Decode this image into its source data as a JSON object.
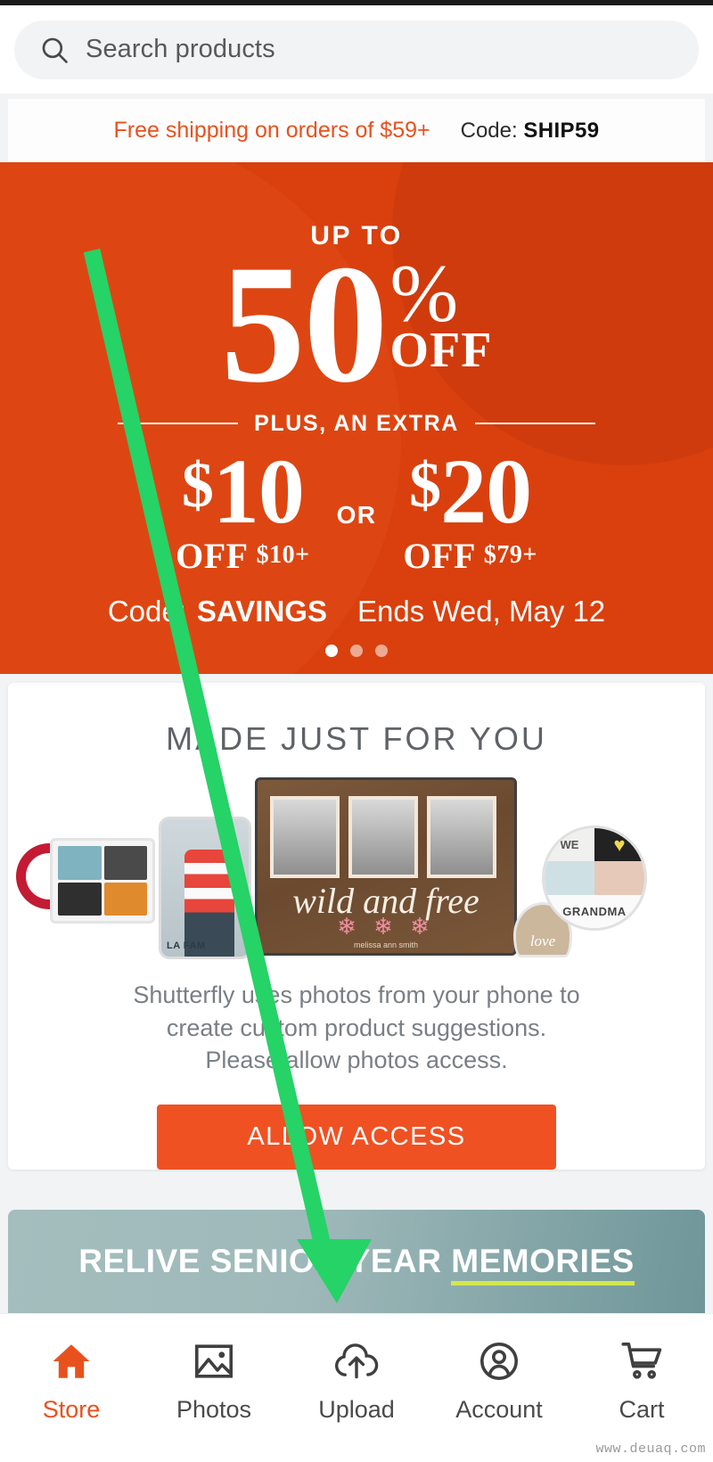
{
  "search": {
    "placeholder": "Search products",
    "icon": "search-icon"
  },
  "promo_strip": {
    "offer": "Free shipping on orders of $59+",
    "code_label": "Code:",
    "code_value": "SHIP59"
  },
  "hero": {
    "up_to": "UP TO",
    "percent_number": "50",
    "percent_symbol": "%",
    "off": "OFF",
    "plus_extra": "PLUS, AN EXTRA",
    "deal_left_amount": "10",
    "deal_left_sub_prefix": "OFF",
    "deal_left_sub_amount": "$10+",
    "or": "OR",
    "deal_right_amount": "20",
    "deal_right_sub_prefix": "OFF",
    "deal_right_sub_amount": "$79+",
    "code_label": "Code:",
    "code_value": "SAVINGS",
    "ends": "Ends Wed, May 12",
    "dots_total": 3,
    "dots_active_index": 0,
    "bg_color": "#d9400e"
  },
  "made_for_you": {
    "title": "MADE JUST FOR YOU",
    "description_line1": "Shutterfly uses photos from your phone to",
    "description_line2": "create custom product suggestions.",
    "description_line3": "Please allow photos access.",
    "allow_button": "ALLOW ACCESS",
    "button_color": "#ef5123",
    "collage": {
      "plaque_script": "wild and free",
      "plaque_signature": "melissa ann smith",
      "disc_we": "WE",
      "disc_heart": "♥",
      "disc_grandma": "GRANDMA",
      "heart_magnet": "love",
      "phone_label": "LA FAM"
    }
  },
  "senior_banner": {
    "text_before": "RELIVE SENIOR YEAR ",
    "text_highlight": "MEMORIES",
    "highlight_color": "#d2e84a"
  },
  "bottom_nav": {
    "items": [
      {
        "label": "Store",
        "icon": "home-icon",
        "active": true
      },
      {
        "label": "Photos",
        "icon": "image-icon",
        "active": false
      },
      {
        "label": "Upload",
        "icon": "upload-cloud-icon",
        "active": false
      },
      {
        "label": "Account",
        "icon": "person-circle-icon",
        "active": false
      },
      {
        "label": "Cart",
        "icon": "shopping-cart-icon",
        "active": false
      }
    ],
    "active_color": "#e8511e"
  },
  "watermark": "www.deuaq.com",
  "annotation": {
    "type": "arrow",
    "color": "#25d366",
    "points_to": "Upload"
  }
}
